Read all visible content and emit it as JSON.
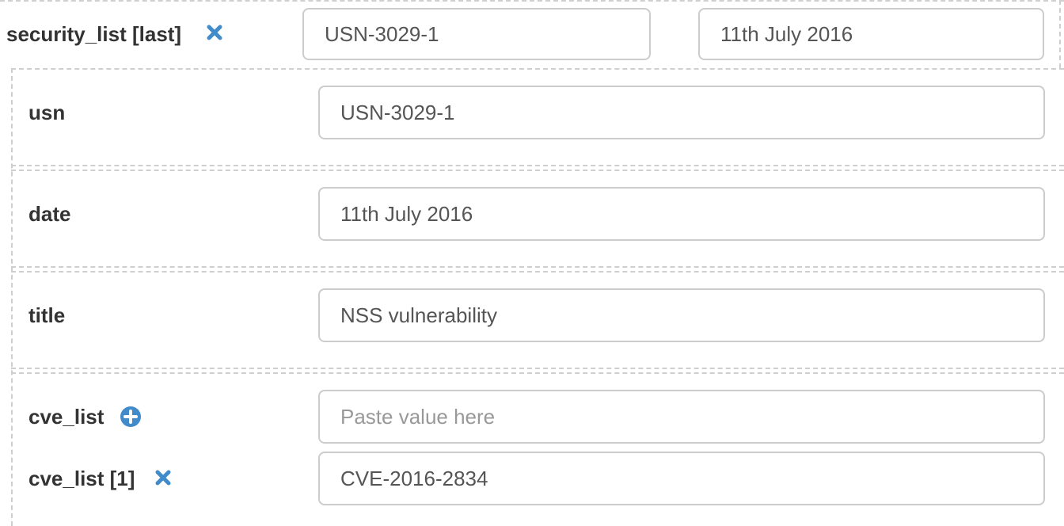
{
  "header": {
    "label": "security_list [last]",
    "usn_value": "USN-3029-1",
    "date_value": "11th July 2016",
    "remove_icon": "times-icon"
  },
  "fields": {
    "usn": {
      "label": "usn",
      "value": "USN-3029-1"
    },
    "date": {
      "label": "date",
      "value": "11th July 2016"
    },
    "title": {
      "label": "title",
      "value": "NSS vulnerability"
    },
    "cve_list": {
      "label": "cve_list",
      "add_icon": "plus-circle-icon",
      "placeholder": "Paste value here",
      "value": ""
    },
    "cve_list_1": {
      "label": "cve_list [1]",
      "remove_icon": "times-icon",
      "value": "CVE-2016-2834"
    }
  },
  "colors": {
    "icon_blue": "#428bca",
    "label_text": "#333333",
    "input_border": "#cccccc",
    "dashed_border": "#cfcfcf",
    "placeholder": "#999999"
  }
}
